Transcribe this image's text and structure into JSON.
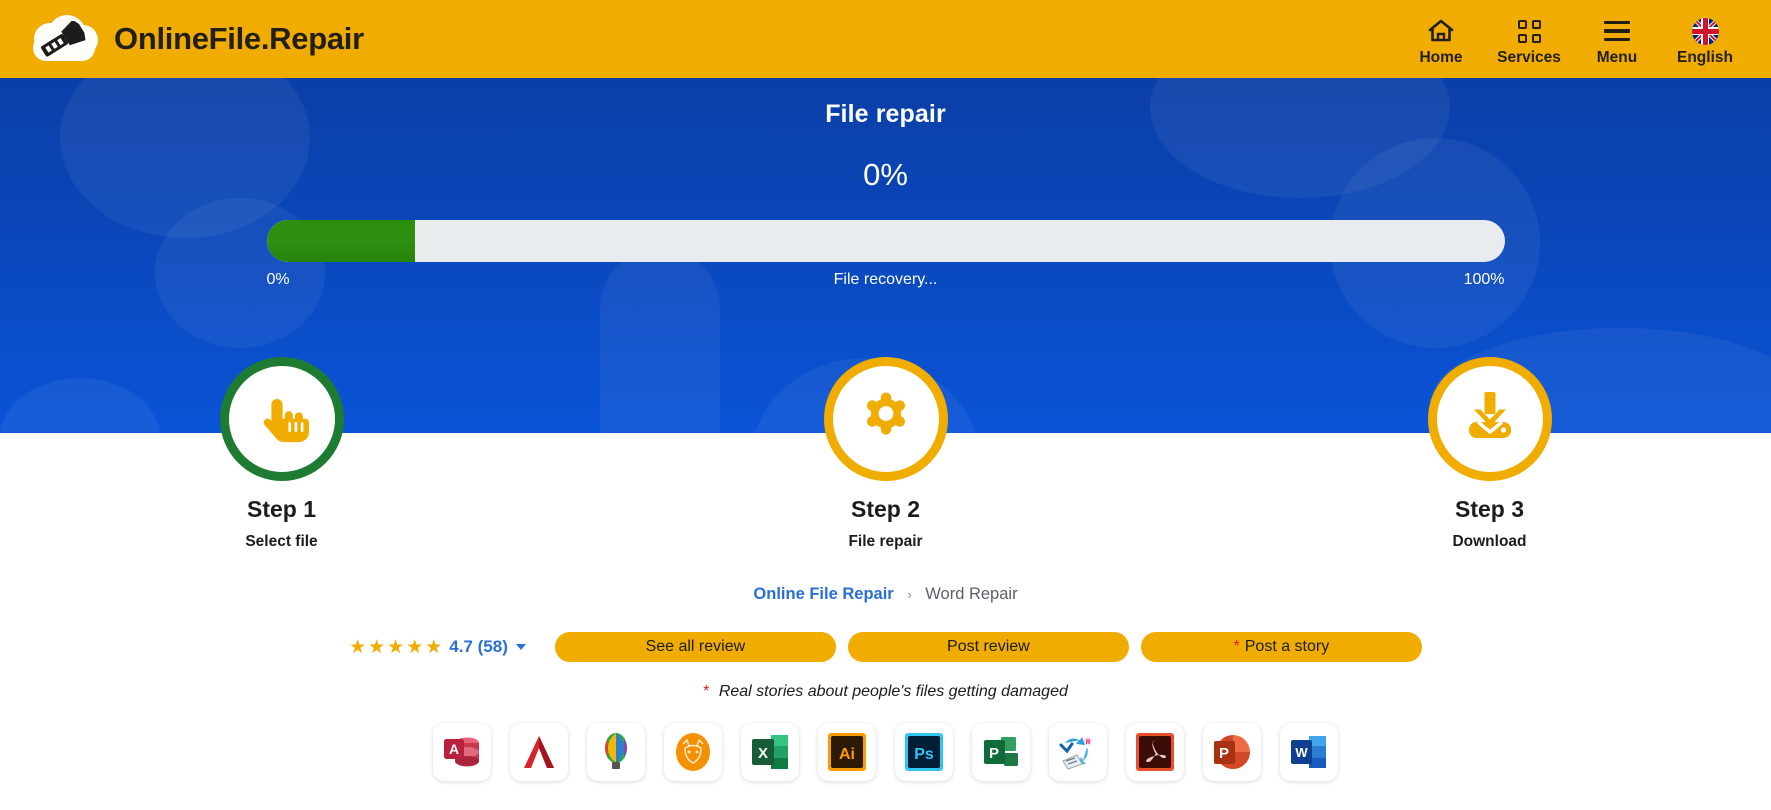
{
  "header": {
    "brand": "OnlineFile.Repair",
    "logo_icon": "cloud-wrench-logo",
    "nav": [
      {
        "label": "Home",
        "icon": "home-icon"
      },
      {
        "label": "Services",
        "icon": "grid-squares-icon"
      },
      {
        "label": "Menu",
        "icon": "hamburger-menu-icon"
      },
      {
        "label": "English",
        "icon": "uk-flag-icon"
      }
    ]
  },
  "hero": {
    "title": "File repair",
    "percent_display": "0%",
    "progress": {
      "value": 0,
      "fill_ratio": 12,
      "left_label": "0%",
      "center_label": "File recovery...",
      "right_label": "100%",
      "fill_color": "#2a8f0c",
      "track_color": "#e9ecef"
    }
  },
  "steps": [
    {
      "number": "Step 1",
      "caption": "Select file",
      "icon": "pointing-hand-icon",
      "ring": "green",
      "ring_color": "#1e7b32"
    },
    {
      "number": "Step 2",
      "caption": "File repair",
      "icon": "gear-icon",
      "ring": "orange",
      "ring_color": "#f0ad00"
    },
    {
      "number": "Step 3",
      "caption": "Download",
      "icon": "download-icon",
      "ring": "orange",
      "ring_color": "#f0ad00"
    }
  ],
  "breadcrumb": {
    "root": "Online File Repair",
    "separator": "›",
    "current": "Word Repair"
  },
  "reviews": {
    "stars": "★★★★★",
    "score": "4.7 (58)",
    "dropdown_icon": "chevron-down-icon",
    "buttons": [
      {
        "label": "See all review",
        "asterisk": false
      },
      {
        "label": "Post review",
        "asterisk": false
      },
      {
        "label": "Post a story",
        "asterisk": true
      }
    ],
    "asterisk": "*",
    "footnote": "Real stories about people's files getting damaged"
  },
  "apps": [
    {
      "name": "access-icon",
      "glyph": "A",
      "fg": "#ffffff",
      "bg": "#a4373a"
    },
    {
      "name": "autocad-icon",
      "glyph": "A",
      "fg": "#d42a2a",
      "bg": "#ffffff"
    },
    {
      "name": "coreldraw-icon",
      "glyph": "",
      "fg": "#2f9e44",
      "bg": "#ffffff"
    },
    {
      "name": "firefox-fox-icon",
      "glyph": "",
      "fg": "#ffffff",
      "bg": "#f59000"
    },
    {
      "name": "excel-icon",
      "glyph": "X",
      "fg": "#ffffff",
      "bg": "#1d7044"
    },
    {
      "name": "illustrator-icon",
      "glyph": "Ai",
      "fg": "#ff9a00",
      "bg": "#2d1a06"
    },
    {
      "name": "photoshop-icon",
      "glyph": "Ps",
      "fg": "#31c5f0",
      "bg": "#001e36"
    },
    {
      "name": "project-icon",
      "glyph": "P",
      "fg": "#ffffff",
      "bg": "#31a05e"
    },
    {
      "name": "backup-sync-icon",
      "glyph": "",
      "fg": "#2aa0e0",
      "bg": "#ffffff"
    },
    {
      "name": "acrobat-pdf-icon",
      "glyph": "",
      "fg": "#e8c8c0",
      "bg": "#3b0b06"
    },
    {
      "name": "powerpoint-icon",
      "glyph": "P",
      "fg": "#ffffff",
      "bg": "#d24726"
    },
    {
      "name": "word-icon",
      "glyph": "W",
      "fg": "#ffffff",
      "bg": "#2b5797"
    }
  ]
}
